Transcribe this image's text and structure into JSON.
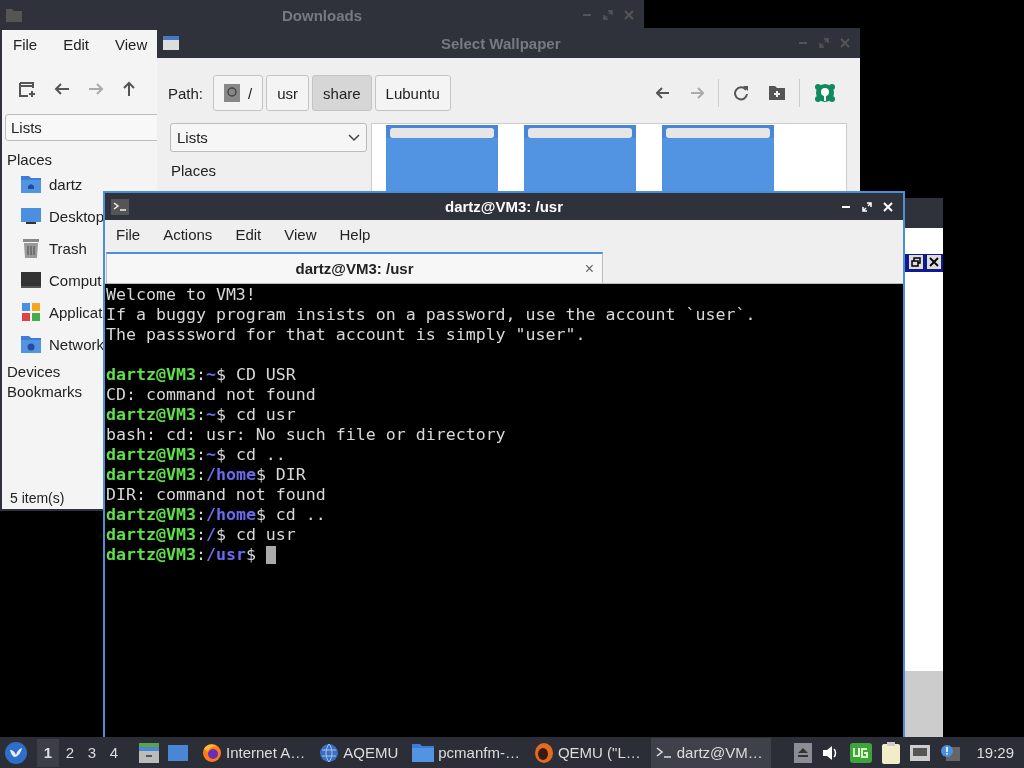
{
  "downloads_window": {
    "title": "Downloads",
    "menu": [
      "File",
      "Edit",
      "View"
    ],
    "location": "Lists",
    "places_heading": "Places",
    "places": [
      {
        "label": "dartz",
        "kind": "home"
      },
      {
        "label": "Desktop",
        "kind": "desktop"
      },
      {
        "label": "Trash",
        "kind": "trash"
      },
      {
        "label": "Comput",
        "kind": "computer"
      },
      {
        "label": "Applicat",
        "kind": "apps"
      },
      {
        "label": "Network",
        "kind": "network"
      }
    ],
    "sections": [
      "Devices",
      "Bookmarks"
    ],
    "status": "5 item(s)"
  },
  "wallpaper_dialog": {
    "title": "Select Wallpaper",
    "path_label": "Path:",
    "path": [
      {
        "label": "/",
        "kind": "root",
        "selected": false
      },
      {
        "label": "usr",
        "kind": "dir",
        "selected": false
      },
      {
        "label": "share",
        "kind": "dir",
        "selected": true
      },
      {
        "label": "Lubuntu",
        "kind": "dir",
        "selected": false
      }
    ],
    "view": "Lists",
    "places_heading": "Places"
  },
  "terminal": {
    "title": "dartz@VM3: /usr",
    "menu": [
      "File",
      "Actions",
      "Edit",
      "View",
      "Help"
    ],
    "tabs": [
      {
        "label": "dartz@VM3: /usr",
        "selected": true,
        "close": "×"
      }
    ],
    "lines": [
      {
        "kind": "output",
        "text": "Welcome to VM3!"
      },
      {
        "kind": "output",
        "text": "If a buggy program insists on a password, use the account `user`."
      },
      {
        "kind": "output",
        "text": "The passsword for that account is simply \"user\"."
      },
      {
        "kind": "blank"
      },
      {
        "kind": "prompt",
        "user": "dartz@VM3",
        "sep": ":",
        "path": "~",
        "command": "$ CD USR"
      },
      {
        "kind": "output",
        "text": "CD: command not found"
      },
      {
        "kind": "prompt",
        "user": "dartz@VM3",
        "sep": ":",
        "path": "~",
        "command": "$ cd usr"
      },
      {
        "kind": "output",
        "text": "bash: cd: usr: No such file or directory"
      },
      {
        "kind": "prompt",
        "user": "dartz@VM3",
        "sep": ":",
        "path": "~",
        "command": "$ cd .."
      },
      {
        "kind": "prompt",
        "user": "dartz@VM3",
        "sep": ":",
        "path": "/home",
        "command": "$ DIR"
      },
      {
        "kind": "output",
        "text": "DIR: command not found"
      },
      {
        "kind": "prompt",
        "user": "dartz@VM3",
        "sep": ":",
        "path": "/home",
        "command": "$ cd .."
      },
      {
        "kind": "prompt",
        "user": "dartz@VM3",
        "sep": ":",
        "path": "/",
        "command": "$ cd usr"
      },
      {
        "kind": "prompt",
        "user": "dartz@VM3",
        "sep": ":",
        "path": "/usr",
        "command": "$"
      }
    ],
    "cursor": true
  },
  "taskbar": {
    "desktops": [
      {
        "label": "1",
        "selected": true
      },
      {
        "label": "2",
        "selected": false
      },
      {
        "label": "3",
        "selected": false
      },
      {
        "label": "4",
        "selected": false
      }
    ],
    "tasks": [
      {
        "label": "Internet A…",
        "kind": "browser",
        "selected": false
      },
      {
        "label": "AQEMU",
        "kind": "globe",
        "selected": false
      },
      {
        "label": "pcmanfm-…",
        "kind": "folder",
        "selected": false
      },
      {
        "label": "QEMU (\"L…",
        "kind": "qemu",
        "selected": false
      },
      {
        "label": "dartz@VM…",
        "kind": "terminal",
        "selected": true
      }
    ],
    "clock": "19:29"
  }
}
